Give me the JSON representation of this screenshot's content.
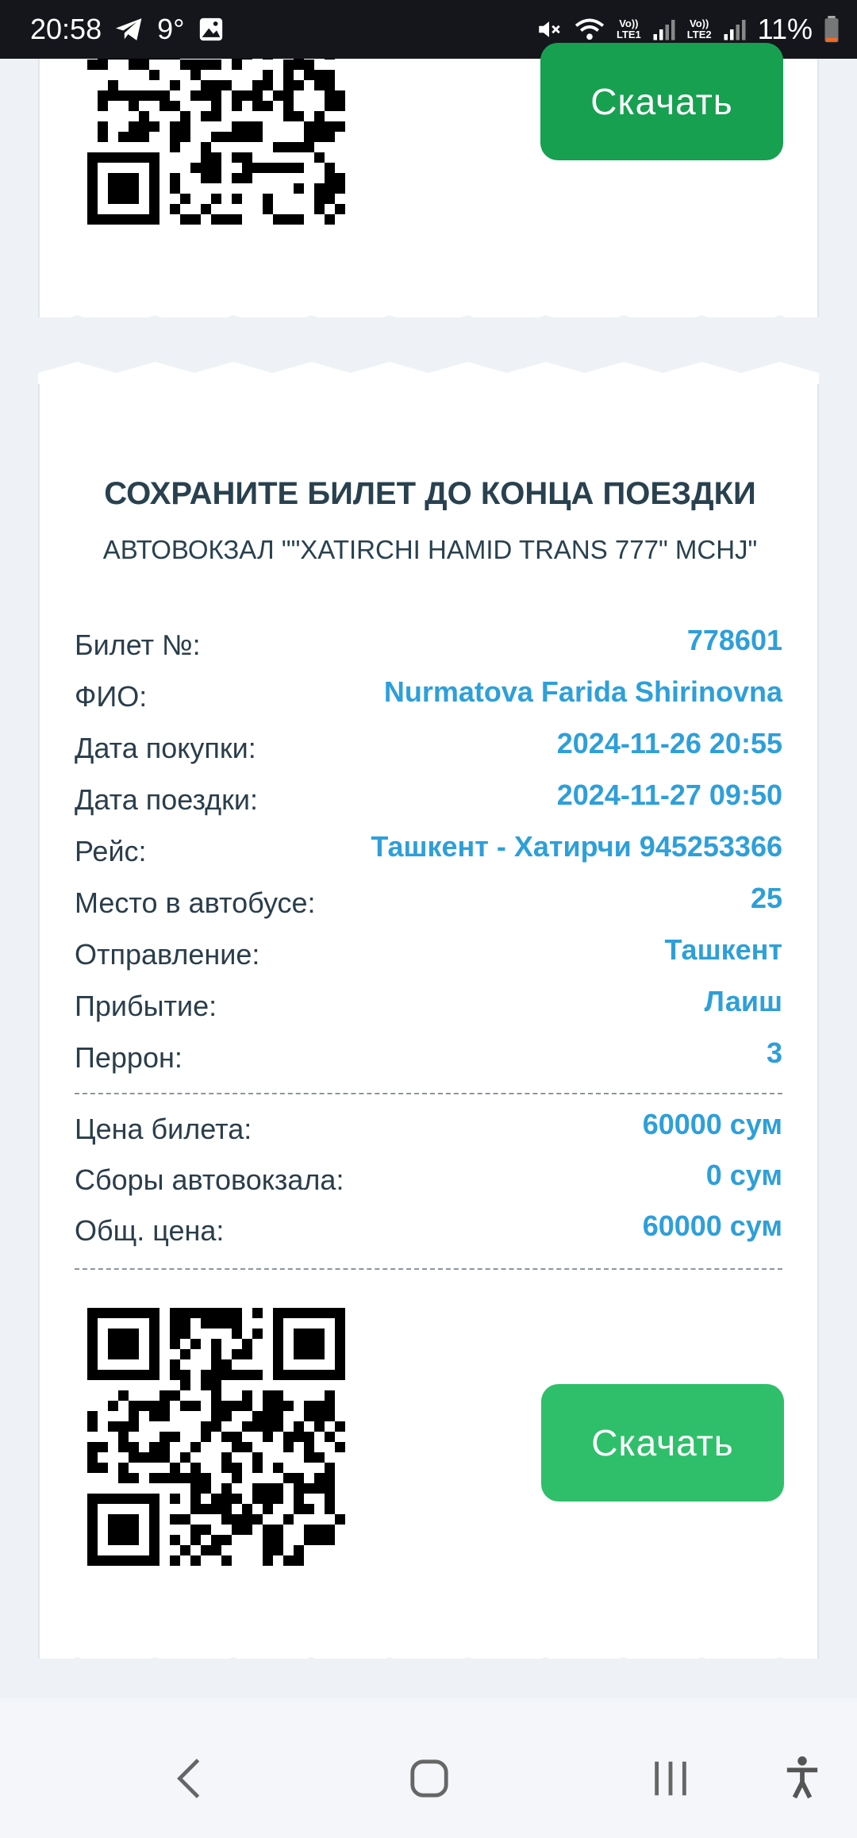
{
  "status_bar": {
    "time": "20:58",
    "temperature": "9°",
    "battery": "11%",
    "sim1": "LTE1",
    "sim2": "LTE2"
  },
  "previous_ticket": {
    "download_label": "Скачать"
  },
  "ticket": {
    "notice": "СОХРАНИТЕ БИЛЕТ ДО КОНЦА ПОЕЗДКИ",
    "station": "АВТОВОКЗАЛ \"\"XATIRCHI HAMID TRANS 777\" MCHJ\"",
    "rows": [
      {
        "label": "Билет №:",
        "value": "778601"
      },
      {
        "label": "ФИО:",
        "value": "Nurmatova Farida Shirinovna"
      },
      {
        "label": "Дата покупки:",
        "value": "2024-11-26 20:55"
      },
      {
        "label": "Дата поездки:",
        "value": "2024-11-27 09:50"
      },
      {
        "label": "Рейс:",
        "value": "Ташкент - Хатирчи 945253366"
      },
      {
        "label": "Место в автобусе:",
        "value": "25"
      },
      {
        "label": "Отправление:",
        "value": "Ташкент"
      },
      {
        "label": "Прибытие:",
        "value": "Лаиш"
      },
      {
        "label": "Перрон:",
        "value": "3"
      }
    ],
    "price_rows": [
      {
        "label": "Цена билета:",
        "value": "60000 сум"
      },
      {
        "label": "Сборы автовокзала:",
        "value": "0 сум"
      },
      {
        "label": "Общ. цена:",
        "value": "60000 сум"
      }
    ],
    "download_label": "Скачать"
  },
  "colors": {
    "accent_blue": "#2e9fd9",
    "button_green_dark": "#16a050",
    "button_green": "#2fbf6a",
    "text_dark": "#2a3d4a"
  },
  "nav": {
    "back": "back-icon",
    "home": "home-icon",
    "recents": "recents-icon",
    "accessibility": "accessibility-icon"
  }
}
